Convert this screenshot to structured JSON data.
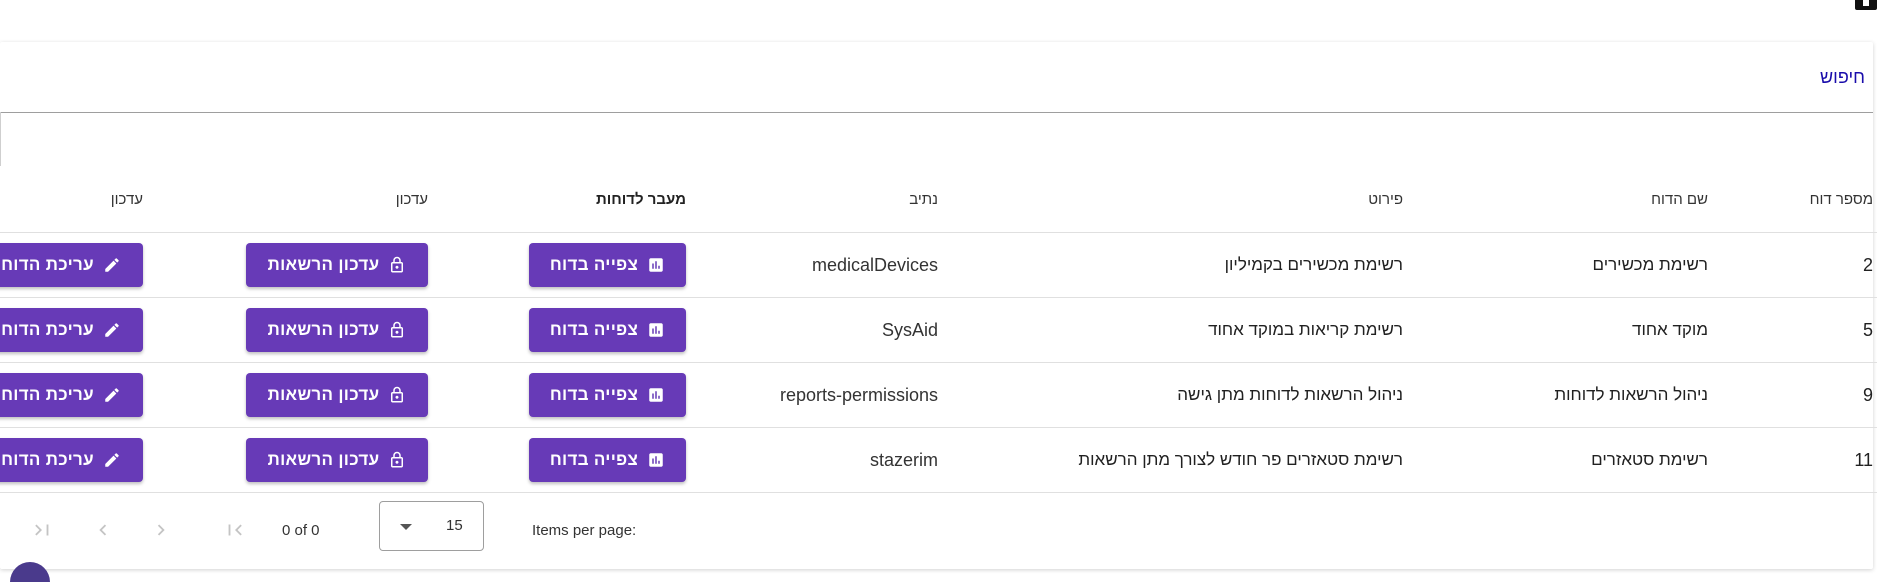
{
  "search": {
    "label": "חיפוש"
  },
  "table": {
    "headers": {
      "number": "מספר דוח",
      "name": "שם הדוח",
      "details": "פירוט",
      "path": "נתיב",
      "goto_reports": "מעבר לדוחות",
      "update_perms": "עדכון",
      "update_edit": "עדכון"
    },
    "rows": [
      {
        "number": "2",
        "name": "רשימת מכשירים",
        "details": "רשימת מכשירים בקמיליון",
        "path": "medicalDevices"
      },
      {
        "number": "5",
        "name": "מוקד אחוד",
        "details": "רשימת קריאות במוקד אחוד",
        "path": "SysAid"
      },
      {
        "number": "9",
        "name": "ניהול הרשאות לדוחות",
        "details": "ניהול הרשאות לדוחות מתן גישה",
        "path": "reports-permissions"
      },
      {
        "number": "11",
        "name": "רשימת סטאזרים",
        "details": "רשימת סטאזרים פר חודש לצורך מתן הרשאות",
        "path": "stazerim"
      }
    ],
    "buttons": {
      "view_label": "צפייה בדוח",
      "perm_label": "עדכון הרשאות",
      "edit_label": "עריכת הדוח"
    }
  },
  "paginator": {
    "items_per_page_label": "Items per page:",
    "items_per_page_value": "15",
    "range_label": "0 of 0"
  },
  "colors": {
    "primary": "#673ab7",
    "link": "#1a0dab"
  },
  "icons": {
    "view": "bar-chart-icon",
    "perm": "lock-open-icon",
    "edit": "pencil-icon",
    "first": "first-page-icon",
    "prev": "chevron-left-icon",
    "next": "chevron-right-icon",
    "last": "last-page-icon"
  }
}
